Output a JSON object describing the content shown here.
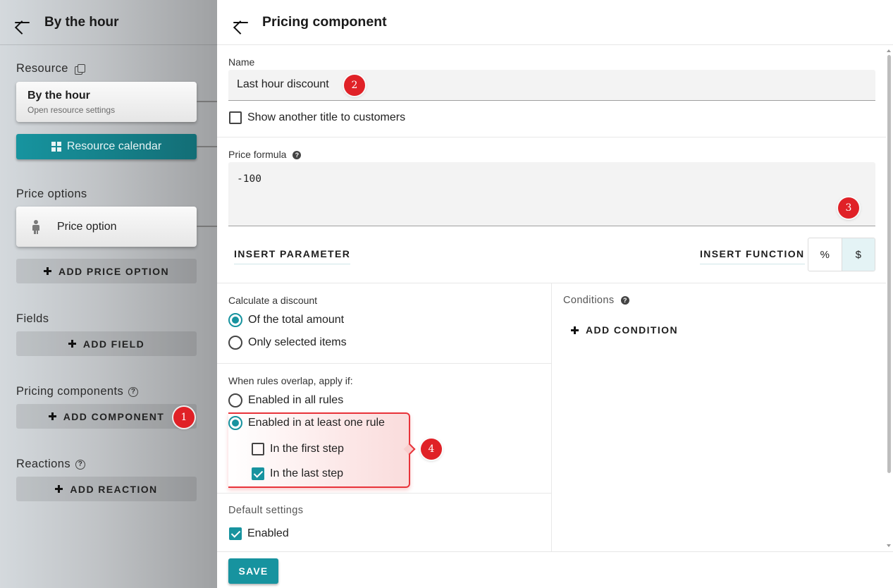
{
  "left_panel": {
    "title": "By the hour",
    "resource_label": "Resource",
    "resource_card": {
      "title": "By the hour",
      "subtitle": "Open resource settings"
    },
    "resource_calendar_label": "Resource calendar",
    "price_options_label": "Price options",
    "price_option_item": "Price option",
    "add_price_option_label": "ADD PRICE OPTION",
    "fields_label": "Fields",
    "add_field_label": "ADD FIELD",
    "pricing_components_label": "Pricing components",
    "add_component_label": "ADD COMPONENT",
    "reactions_label": "Reactions",
    "add_reaction_label": "ADD REACTION"
  },
  "drawer": {
    "title": "Pricing component",
    "name_label": "Name",
    "name_value": "Last hour discount",
    "show_title_label": "Show another title to customers",
    "show_title_checked": false,
    "price_formula_label": "Price formula",
    "price_formula_value": "-100",
    "insert_parameter_label": "INSERT PARAMETER",
    "insert_function_label": "INSERT FUNCTION",
    "unit_options": [
      "%",
      "$"
    ],
    "unit_selected": "$",
    "calculate_discount_label": "Calculate a discount",
    "calculate_options": [
      {
        "label": "Of the total amount",
        "selected": true
      },
      {
        "label": "Only selected items",
        "selected": false
      }
    ],
    "overlap_label": "When rules overlap, apply if:",
    "overlap_options": [
      {
        "label": "Enabled in all rules",
        "selected": false
      },
      {
        "label": "Enabled in at least one rule",
        "selected": true
      }
    ],
    "step_options": [
      {
        "label": "In the first step",
        "checked": false
      },
      {
        "label": "In the last step",
        "checked": true
      }
    ],
    "default_settings_label": "Default settings",
    "enabled_label": "Enabled",
    "enabled_checked": true,
    "conditions_label": "Conditions",
    "add_condition_label": "ADD CONDITION",
    "save_label": "SAVE"
  },
  "annotations": [
    "1",
    "2",
    "3",
    "4"
  ],
  "colors": {
    "accent": "#17939f",
    "badge": "#e02127"
  }
}
